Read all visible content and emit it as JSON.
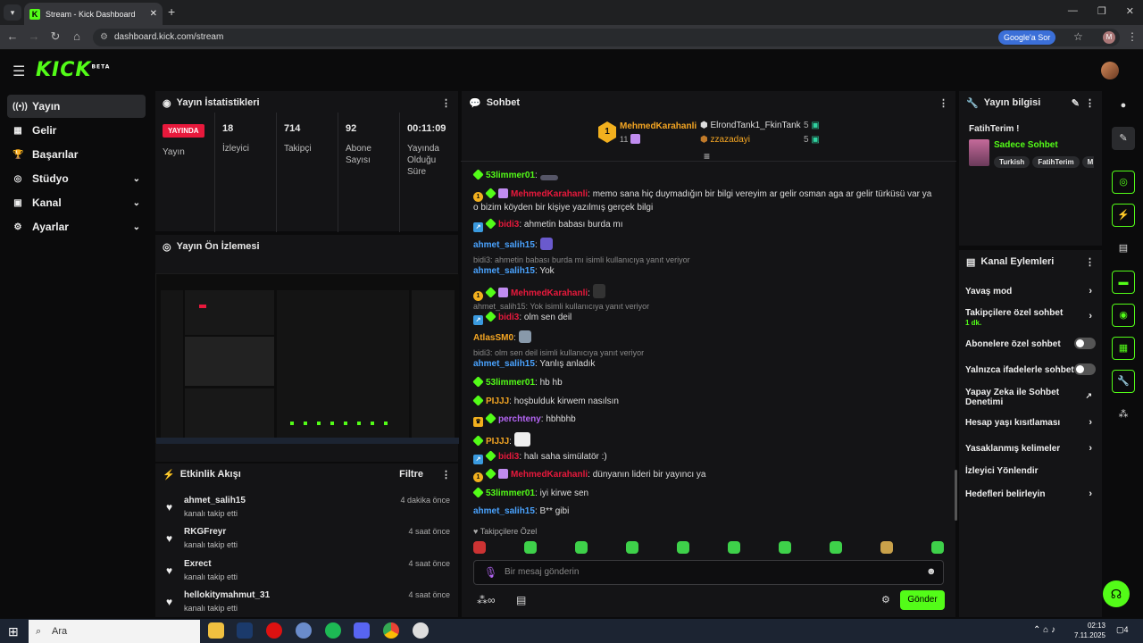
{
  "browser": {
    "tab_title": "Stream - Kick Dashboard",
    "tab_favicon_letter": "K",
    "url": "dashboard.kick.com/stream",
    "google_button": "Google'a Sor",
    "profile_initial": "M"
  },
  "app": {
    "logo": "KICK",
    "logo_badge": "BETA",
    "sidebar": [
      {
        "label": "Yayın",
        "icon": "broadcast-icon",
        "active": true
      },
      {
        "label": "Gelir",
        "icon": "revenue-icon"
      },
      {
        "label": "Başarılar",
        "icon": "trophy-icon"
      },
      {
        "label": "Stüdyo",
        "icon": "studio-icon",
        "expandable": true
      },
      {
        "label": "Kanal",
        "icon": "channel-icon",
        "expandable": true
      },
      {
        "label": "Ayarlar",
        "icon": "gear-icon",
        "expandable": true
      }
    ]
  },
  "stats": {
    "title": "Yayın İstatistikleri",
    "live_badge": "YAYINDA",
    "live_label": "Yayın",
    "viewers": {
      "value": "18",
      "label": "İzleyici"
    },
    "followers": {
      "value": "714",
      "label": "Takipçi"
    },
    "subs": {
      "value": "92",
      "label": "Abone Sayısı"
    },
    "uptime": {
      "value": "00:11:09",
      "label": "Yayında Olduğu Süre"
    }
  },
  "preview": {
    "title": "Yayın Ön İzlemesi"
  },
  "events": {
    "title": "Etkinlik Akışı",
    "filter": "Filtre",
    "items": [
      {
        "name": "ahmet_salih15",
        "desc": "kanalı takip etti",
        "time": "4 dakika önce"
      },
      {
        "name": "RKGFreyr",
        "desc": "kanalı takip etti",
        "time": "4 saat önce"
      },
      {
        "name": "Exrect",
        "desc": "kanalı takip etti",
        "time": "4 saat önce"
      },
      {
        "name": "hellokitymahmut_31",
        "desc": "kanalı takip etti",
        "time": "4 saat önce"
      }
    ]
  },
  "chat": {
    "title": "Sohbet",
    "leaders": [
      {
        "rank": "1",
        "name": "MehmedKarahanli",
        "count": "11"
      },
      {
        "name": "ElrondTank1_FkinTank",
        "count": "5"
      },
      {
        "name": "zzazadayi",
        "count": "5"
      }
    ],
    "messages": [
      {
        "user": "53limmer01",
        "text": ""
      },
      {
        "user": "MehmedKarahanli",
        "text": "memo sana hiç duymadığın bir bilgi vereyim ar gelir osman aga ar gelir türküsü var ya o bizim köyden bir kişiye yazılmış gerçek bilgi"
      },
      {
        "user": "bidi3",
        "text": "ahmetin babası burda mı"
      },
      {
        "user": "ahmet_salih15",
        "text": ""
      },
      {
        "reply": "bidi3: ahmetin babası burda mı isimli kullanıcıya yanıt veriyor",
        "user": "ahmet_salih15",
        "text": "Yok"
      },
      {
        "user": "MehmedKarahanli",
        "text": ""
      },
      {
        "reply": "ahmet_salih15: Yok isimli kullanıcıya yanıt veriyor",
        "user": "bidi3",
        "text": "olm sen deil"
      },
      {
        "user": "AtlasSM0",
        "text": ""
      },
      {
        "reply": "bidi3: olm sen deil isimli kullanıcıya yanıt veriyor",
        "user": "ahmet_salih15",
        "text": "Yanlış anladık"
      },
      {
        "user": "53limmer01",
        "text": "hb hb"
      },
      {
        "user": "PIJJJ",
        "text": "hoşbulduk kirwem nasılsın"
      },
      {
        "user": "perchteny",
        "text": "hbhbhb"
      },
      {
        "user": "PIJJJ",
        "text": ""
      },
      {
        "user": "bidi3",
        "text": "halı saha simülatör :)"
      },
      {
        "user": "MehmedKarahanli",
        "text": "dünyanın lideri bir yayıncı ya"
      },
      {
        "user": "53limmer01",
        "text": "iyi kirwe sen"
      },
      {
        "user": "ahmet_salih15",
        "text": "B** gibi"
      }
    ],
    "follower_only": "Takipçilere Özel",
    "input_placeholder": "Bir mesaj gönderin",
    "send": "Gönder"
  },
  "info": {
    "title": "Yayın bilgisi",
    "stream_title": "FatihTerim !",
    "category": "Sadece Sohbet",
    "tags": [
      "Turkish",
      "FatihTerim",
      "M"
    ]
  },
  "actions": {
    "title": "Kanal Eylemleri",
    "items": [
      {
        "label": "Yavaş mod"
      },
      {
        "label": "Takipçilere özel sohbet",
        "sub": "1 dk."
      },
      {
        "label": "Abonelere özel sohbet"
      },
      {
        "label": "Yalnızca ifadelerle sohbet"
      },
      {
        "label": "Yapay Zeka ile Sohbet Denetimi"
      },
      {
        "label": "Hesap yaşı kısıtlaması"
      },
      {
        "label": "Yasaklanmış kelimeler"
      },
      {
        "label": "İzleyici Yönlendir"
      },
      {
        "label": "Hedefleri belirleyin"
      }
    ]
  },
  "taskbar": {
    "search": "Ara",
    "time": "02:13",
    "date": "7.11.2025",
    "badge": "4"
  },
  "colors": {
    "accent": "#53fc18",
    "live": "#e8193c",
    "panel": "#141416"
  }
}
